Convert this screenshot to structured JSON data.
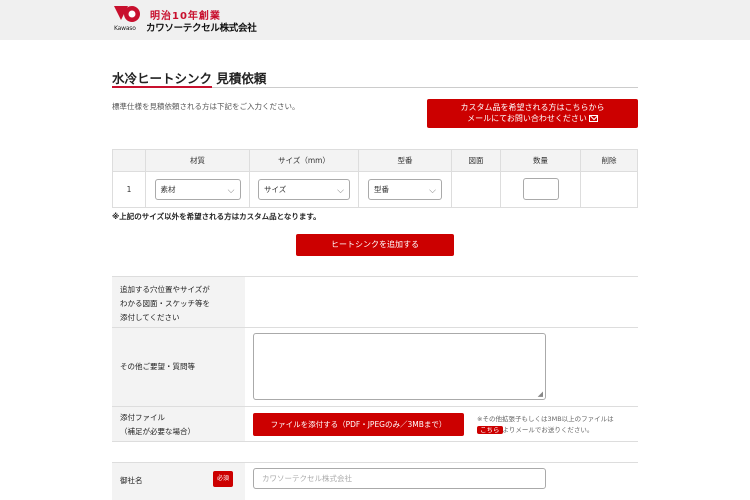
{
  "header": {
    "logo_small": "Kawaso",
    "logo_line1": "明治10年創業",
    "logo_line2": "カワソーテクセル株式会社",
    "brand_color": "#c8102e"
  },
  "page": {
    "title": "水冷ヒートシンク 見積依頼",
    "intro": "標準仕様を見積依頼される方は下記をご入力ください。",
    "custom_button_line1": "カスタム品を希望される方はこちらから",
    "custom_button_line2": "メールにてお問い合わせください"
  },
  "table": {
    "headers": [
      "",
      "材質",
      "サイズ（mm）",
      "型番",
      "図面",
      "数量",
      "削除"
    ],
    "rows": [
      {
        "no": "1",
        "material": "素材",
        "size": "サイズ",
        "model": "型番"
      }
    ]
  },
  "note": "※上記のサイズ以外を希望される方はカスタム品となります。",
  "add_button": "ヒートシンクを追加する",
  "form": {
    "drawing_label": [
      "追加する穴位置やサイズが",
      "わかる図面・スケッチ等を",
      "添付してください"
    ],
    "other_label": "その他ご要望・質問等",
    "attach_label_1": "添付ファイル",
    "attach_label_2": "（補足が必要な場合）",
    "attach_button": "ファイルを添付する（PDF・JPEGのみ／3MBまで）",
    "attach_note_1": "※その他拡張子もしくは3MB以上のファイルは",
    "attach_note_link": "こちら",
    "attach_note_2": "よりメールでお送りください。",
    "company_label": "御社名",
    "required_badge": "必須",
    "company_placeholder": "カワソーテクセル株式会社"
  }
}
